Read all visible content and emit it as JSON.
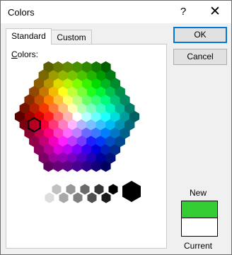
{
  "window": {
    "title": "Colors",
    "help_label": "?",
    "close_label": "✕"
  },
  "tabs": [
    {
      "label": "Standard",
      "selected": true
    },
    {
      "label": "Custom",
      "selected": false
    }
  ],
  "colors_label_prefix": "C",
  "colors_label_rest": "olors:",
  "buttons": {
    "ok": "OK",
    "cancel": "Cancel"
  },
  "preview": {
    "new_label": "New",
    "current_label": "Current",
    "new_color": "#33cc33",
    "current_color": "#ffffff"
  },
  "icons": {
    "help": "help-icon",
    "close": "close-icon"
  }
}
